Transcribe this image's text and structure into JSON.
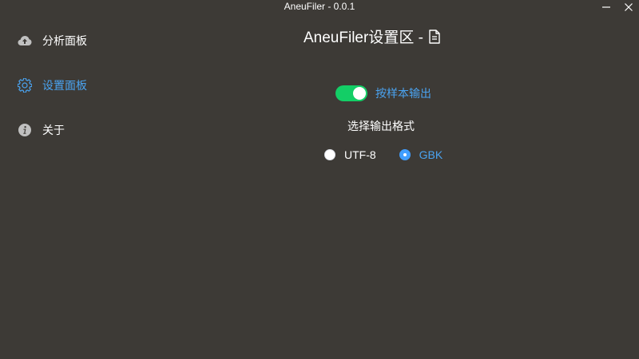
{
  "window": {
    "title": "AneuFiler - 0.0.1",
    "minimize_icon": "minimize-icon",
    "close_icon": "close-icon"
  },
  "sidebar": {
    "items": [
      {
        "label": "分析面板",
        "icon": "cloud-upload-icon",
        "active": false
      },
      {
        "label": "设置面板",
        "icon": "gear-icon",
        "active": true
      },
      {
        "label": "关于",
        "icon": "info-icon",
        "active": false
      }
    ]
  },
  "main": {
    "title": "AneuFiler设置区 -",
    "title_icon": "document-icon",
    "toggle": {
      "label": "按样本输出",
      "on": true
    },
    "format_label": "选择输出格式",
    "radios": [
      {
        "label": "UTF-8",
        "checked": false
      },
      {
        "label": "GBK",
        "checked": true
      }
    ]
  },
  "colors": {
    "background": "#3d3a36",
    "accent": "#4aa3f0",
    "switch_on": "#13ce66",
    "radio_checked": "#409eff"
  }
}
